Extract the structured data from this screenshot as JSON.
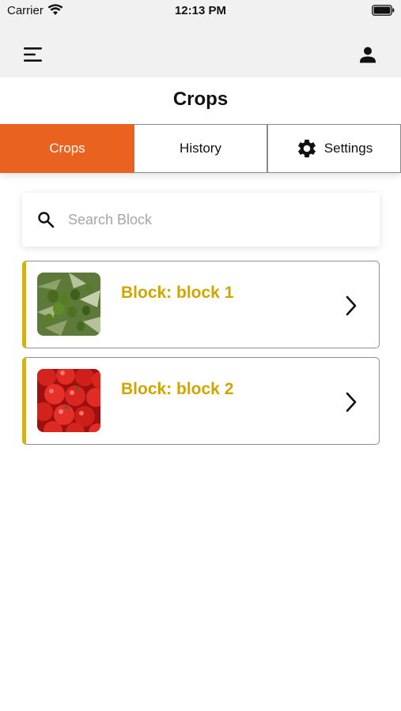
{
  "status_bar": {
    "carrier": "Carrier",
    "time": "12:13 PM"
  },
  "nav": {
    "menu_icon": "hamburger-menu-icon",
    "profile_icon": "user-icon"
  },
  "page": {
    "title": "Crops"
  },
  "tabs": [
    {
      "label": "Crops",
      "active": true
    },
    {
      "label": "History",
      "active": false
    },
    {
      "label": "Settings",
      "active": false,
      "icon": "gear-icon"
    }
  ],
  "search": {
    "placeholder": "Search Block",
    "value": ""
  },
  "blocks": [
    {
      "label": "Block: block 1",
      "image": "olives-photo"
    },
    {
      "label": "Block: block 2",
      "image": "tomatoes-photo"
    }
  ],
  "colors": {
    "accent": "#e9621f",
    "block_title": "#d1a500",
    "card_stripe": "#d1b120"
  }
}
